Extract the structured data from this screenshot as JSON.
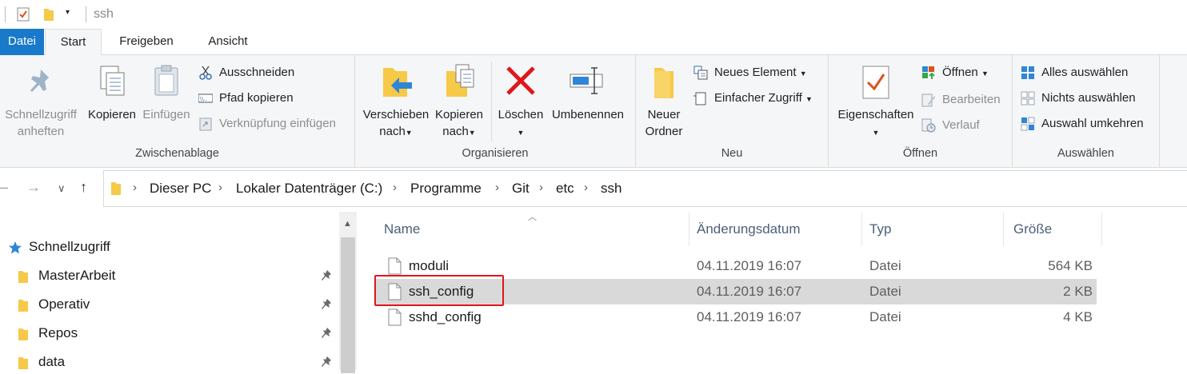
{
  "window": {
    "title": "ssh"
  },
  "tabs": [
    {
      "label": "Datei"
    },
    {
      "label": "Start"
    },
    {
      "label": "Freigeben"
    },
    {
      "label": "Ansicht"
    }
  ],
  "ribbon": {
    "clipboard": {
      "label": "Zwischenablage",
      "pin_quick_access": "Schnellzugriff\nanheften",
      "pin_line1": "Schnellzugriff",
      "pin_line2": "anheften",
      "copy": "Kopieren",
      "paste": "Einfügen",
      "cut": "Ausschneiden",
      "copy_path": "Pfad kopieren",
      "paste_shortcut": "Verknüpfung einfügen"
    },
    "organize": {
      "label": "Organisieren",
      "move_line1": "Verschieben",
      "move_line2": "nach",
      "copyto_line1": "Kopieren",
      "copyto_line2": "nach",
      "delete": "Löschen",
      "rename": "Umbenennen"
    },
    "new": {
      "label": "Neu",
      "new_folder_line1": "Neuer",
      "new_folder_line2": "Ordner",
      "new_item": "Neues Element",
      "easy_access": "Einfacher Zugriff"
    },
    "open": {
      "label": "Öffnen",
      "properties": "Eigenschaften",
      "open": "Öffnen",
      "edit": "Bearbeiten",
      "history": "Verlauf"
    },
    "select": {
      "label": "Auswählen",
      "select_all": "Alles auswählen",
      "select_none": "Nichts auswählen",
      "invert": "Auswahl umkehren"
    }
  },
  "breadcrumb": [
    "Dieser PC",
    "Lokaler Datenträger (C:)",
    "Programme",
    "Git",
    "etc",
    "ssh"
  ],
  "navpane": {
    "quick_access": "Schnellzugriff",
    "items": [
      {
        "label": "MasterArbeit"
      },
      {
        "label": "Operativ"
      },
      {
        "label": "Repos"
      },
      {
        "label": "data"
      }
    ]
  },
  "filelist": {
    "columns": {
      "name": "Name",
      "date": "Änderungsdatum",
      "type": "Typ",
      "size": "Größe"
    },
    "rows": [
      {
        "name": "moduli",
        "date": "04.11.2019 16:07",
        "type": "Datei",
        "size": "564 KB",
        "selected": false
      },
      {
        "name": "ssh_config",
        "date": "04.11.2019 16:07",
        "type": "Datei",
        "size": "2 KB",
        "selected": true
      },
      {
        "name": "sshd_config",
        "date": "04.11.2019 16:07",
        "type": "Datei",
        "size": "4 KB",
        "selected": false
      }
    ]
  },
  "colors": {
    "file_tab": "#1979ca",
    "folder": "#f7c948",
    "delete_red": "#e0161d",
    "selection": "#d9d9d9",
    "highlight": "#e0161d"
  }
}
